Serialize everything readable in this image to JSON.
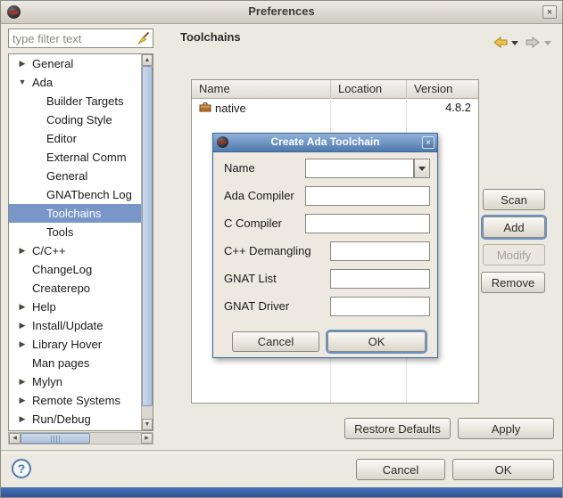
{
  "window": {
    "title": "Preferences",
    "close_label": "×"
  },
  "sidebar": {
    "filter_placeholder": "type filter text",
    "items": [
      {
        "label": "General",
        "level": 0,
        "twistie": "collapsed",
        "selected": false
      },
      {
        "label": "Ada",
        "level": 0,
        "twistie": "expanded",
        "selected": false
      },
      {
        "label": "Builder Targets",
        "level": 1,
        "twistie": "none",
        "selected": false
      },
      {
        "label": "Coding Style",
        "level": 1,
        "twistie": "none",
        "selected": false
      },
      {
        "label": "Editor",
        "level": 1,
        "twistie": "none",
        "selected": false
      },
      {
        "label": "External Comm",
        "level": 1,
        "twistie": "none",
        "selected": false
      },
      {
        "label": "General",
        "level": 1,
        "twistie": "none",
        "selected": false
      },
      {
        "label": "GNATbench Log",
        "level": 1,
        "twistie": "none",
        "selected": false
      },
      {
        "label": "Toolchains",
        "level": 1,
        "twistie": "none",
        "selected": true
      },
      {
        "label": "Tools",
        "level": 1,
        "twistie": "none",
        "selected": false
      },
      {
        "label": "C/C++",
        "level": 0,
        "twistie": "collapsed",
        "selected": false
      },
      {
        "label": "ChangeLog",
        "level": 0,
        "twistie": "none",
        "selected": false
      },
      {
        "label": "Createrepo",
        "level": 0,
        "twistie": "none",
        "selected": false
      },
      {
        "label": "Help",
        "level": 0,
        "twistie": "collapsed",
        "selected": false
      },
      {
        "label": "Install/Update",
        "level": 0,
        "twistie": "collapsed",
        "selected": false
      },
      {
        "label": "Library Hover",
        "level": 0,
        "twistie": "collapsed",
        "selected": false
      },
      {
        "label": "Man pages",
        "level": 0,
        "twistie": "none",
        "selected": false
      },
      {
        "label": "Mylyn",
        "level": 0,
        "twistie": "collapsed",
        "selected": false
      },
      {
        "label": "Remote Systems",
        "level": 0,
        "twistie": "collapsed",
        "selected": false
      },
      {
        "label": "Run/Debug",
        "level": 0,
        "twistie": "collapsed",
        "selected": false
      }
    ]
  },
  "content": {
    "title": "Toolchains",
    "table": {
      "headers": [
        "Name",
        "Location",
        "Version"
      ],
      "rows": [
        {
          "name": "native",
          "location": "",
          "version": "4.8.2"
        }
      ]
    },
    "buttons": {
      "scan": "Scan",
      "add": "Add",
      "modify": "Modify",
      "remove": "Remove",
      "restore_defaults": "Restore Defaults",
      "apply": "Apply"
    }
  },
  "dialog": {
    "title": "Create Ada Toolchain",
    "close_label": "×",
    "fields": [
      {
        "label": "Name",
        "type": "combo",
        "value": ""
      },
      {
        "label": "Ada Compiler",
        "type": "text",
        "value": ""
      },
      {
        "label": "C Compiler",
        "type": "text",
        "value": ""
      },
      {
        "label": "C++ Demangling",
        "type": "text",
        "value": ""
      },
      {
        "label": "GNAT List",
        "type": "text",
        "value": ""
      },
      {
        "label": "GNAT Driver",
        "type": "text",
        "value": ""
      }
    ],
    "buttons": {
      "cancel": "Cancel",
      "ok": "OK"
    }
  },
  "footer": {
    "help": "?",
    "cancel": "Cancel",
    "ok": "OK"
  },
  "colors": {
    "selection_blue": "#7896C8",
    "dialog_titlebar_blue": "#4E7AAC",
    "focus_ring_blue": "#6C92C4",
    "back_arrow_gold": "#EFC44D",
    "bottom_strip_blue": "#3A64A8"
  }
}
